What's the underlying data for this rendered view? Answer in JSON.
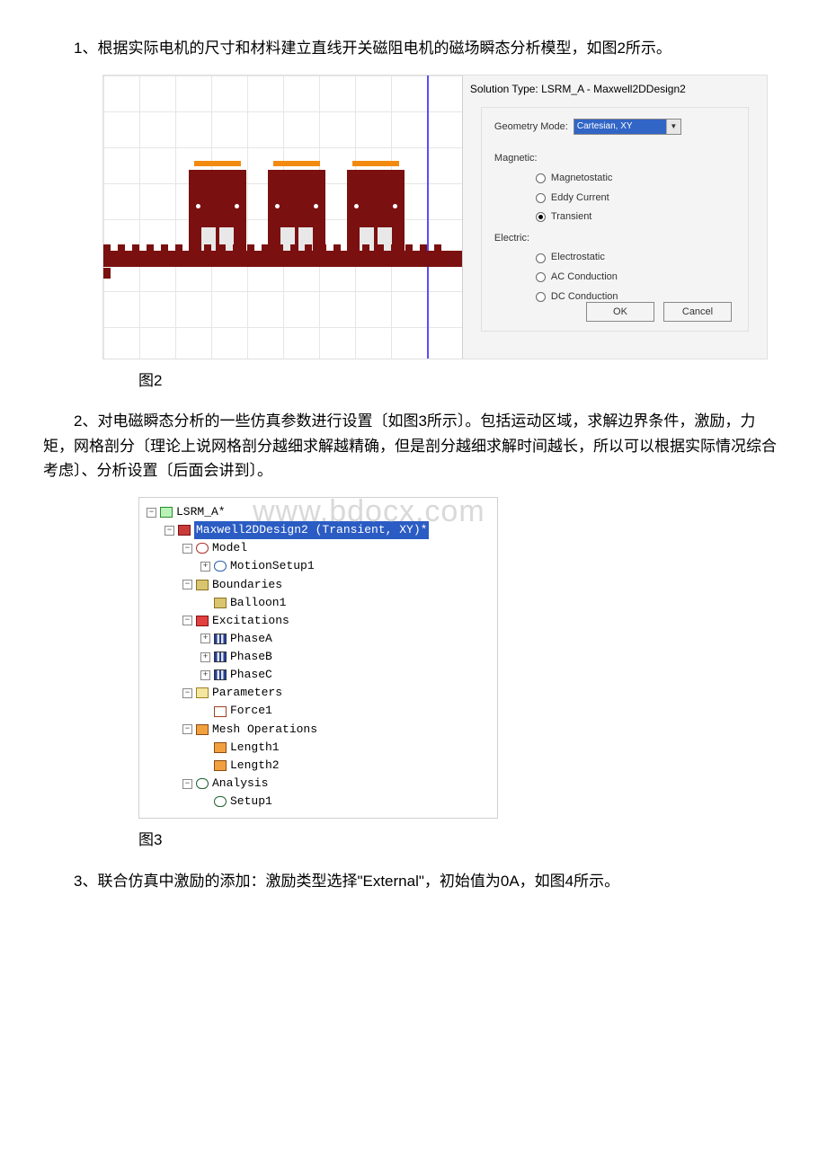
{
  "para1": "1、根据实际电机的尺寸和材料建立直线开关磁阻电机的磁场瞬态分析模型，如图2所示。",
  "fig2_label": "图2",
  "para2": "2、对电磁瞬态分析的一些仿真参数进行设置〔如图3所示〕。包括运动区域，求解边界条件，激励，力矩，网格剖分〔理论上说网格剖分越细求解越精确，但是剖分越细求解时间越长，所以可以根据实际情况综合考虑〕、分析设置〔后面会讲到〕。",
  "fig3_label": "图3",
  "para3": "3、联合仿真中激励的添加：激励类型选择\"External\"，初始值为0A，如图4所示。",
  "watermark": "www.bdocx.com",
  "dialog": {
    "title": "Solution Type: LSRM_A - Maxwell2DDesign2",
    "geom_label": "Geometry Mode:",
    "geom_value": "Cartesian, XY",
    "magnetic_label": "Magnetic:",
    "options_mag": {
      "magnetostatic": "Magnetostatic",
      "eddy": "Eddy Current",
      "transient": "Transient"
    },
    "electric_label": "Electric:",
    "options_elec": {
      "electrostatic": "Electrostatic",
      "ac": "AC Conduction",
      "dc": "DC Conduction"
    },
    "ok": "OK",
    "cancel": "Cancel"
  },
  "tree": {
    "root": "LSRM_A*",
    "design": "Maxwell2DDesign2 (Transient, XY)*",
    "model": "Model",
    "motion": "MotionSetup1",
    "boundaries": "Boundaries",
    "balloon": "Balloon1",
    "excitations": "Excitations",
    "phaseA": "PhaseA",
    "phaseB": "PhaseB",
    "phaseC": "PhaseC",
    "parameters": "Parameters",
    "force": "Force1",
    "mesh": "Mesh Operations",
    "len1": "Length1",
    "len2": "Length2",
    "analysis": "Analysis",
    "setup": "Setup1"
  }
}
